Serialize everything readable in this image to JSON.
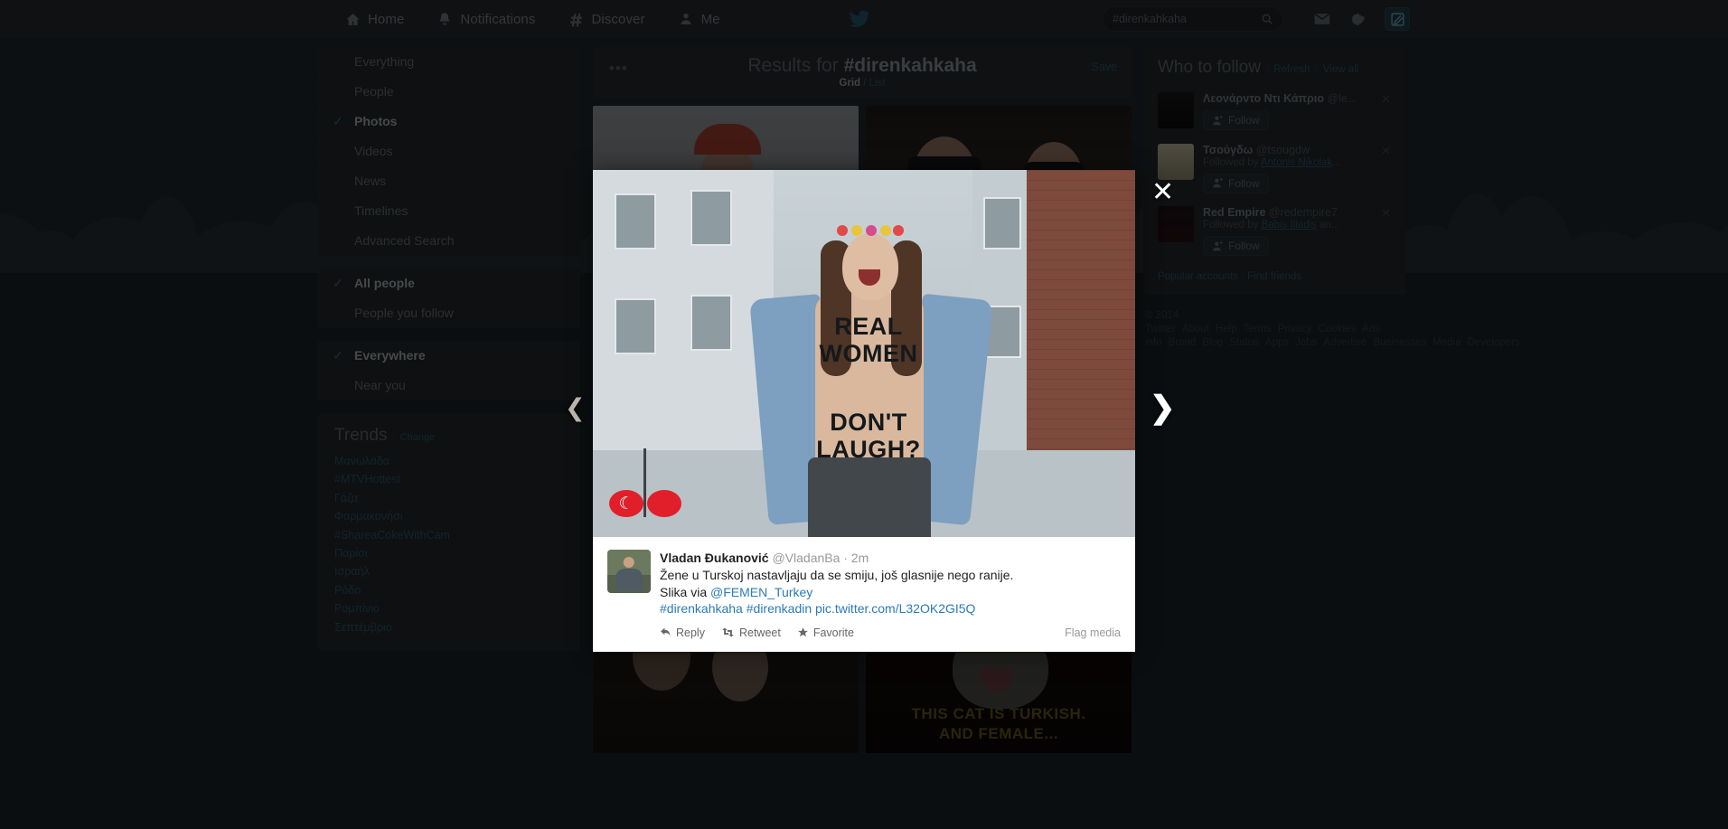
{
  "topnav": {
    "items": [
      {
        "label": "Home",
        "icon": "home-icon"
      },
      {
        "label": "Notifications",
        "icon": "bell-icon"
      },
      {
        "label": "Discover",
        "icon": "hash-icon"
      },
      {
        "label": "Me",
        "icon": "person-icon"
      }
    ],
    "logo_icon": "twitter-bird-icon",
    "search": {
      "value": "#direnkahkaha",
      "placeholder": "Search",
      "icon": "search-icon"
    },
    "messages_icon": "envelope-icon",
    "settings_icon": "gear-icon",
    "compose_icon": "compose-tweet-icon"
  },
  "sidebar": {
    "filters": [
      {
        "label": "Everything",
        "active": false
      },
      {
        "label": "People",
        "active": false
      },
      {
        "label": "Photos",
        "active": true
      },
      {
        "label": "Videos",
        "active": false
      },
      {
        "label": "News",
        "active": false
      },
      {
        "label": "Timelines",
        "active": false
      },
      {
        "label": "Advanced Search",
        "active": false
      }
    ],
    "people_filters": [
      {
        "label": "All people",
        "active": true
      },
      {
        "label": "People you follow",
        "active": false
      }
    ],
    "place_filters": [
      {
        "label": "Everywhere",
        "active": true
      },
      {
        "label": "Near you",
        "active": false
      }
    ],
    "trends": {
      "title": "Trends",
      "separator": "·",
      "change_label": "Change",
      "items": [
        "Μανωλάδα",
        "#MTVHottest",
        "Γάζα",
        "Φαρμακονήσι",
        "#ShareaCokeWithCam",
        "Παρίσι",
        "Ισραήλ",
        "Ρόδο",
        "Ρομπίνιο",
        "Σεπτέμβριο"
      ]
    }
  },
  "results": {
    "title_prefix": "Results for ",
    "query": "#direnkahkaha",
    "save_label": "Save",
    "more_icon": "more-options-icon",
    "views": {
      "grid_label": "Grid",
      "divider": "/",
      "list_label": "List",
      "active": "Grid"
    },
    "thumbnails": [
      {
        "name": "laughing-woman-street",
        "caption": ""
      },
      {
        "name": "women-in-sunglasses-car",
        "caption": ""
      },
      {
        "name": "laughing-couple-at-party",
        "caption": ""
      },
      {
        "name": "turkish-cat-meme",
        "caption": "THIS CAT IS TURKISH.\nAND FEMALE..."
      }
    ]
  },
  "who_to_follow": {
    "title": "Who to follow",
    "refresh_label": "Refresh",
    "view_all_label": "View all",
    "separator": "·",
    "follow_label": "Follow",
    "follow_icon": "add-person-icon",
    "dismiss_icon": "close-icon",
    "accounts": [
      {
        "name": "Λεονάρντο Ντι Κάπριο",
        "handle": "@le...",
        "context": "",
        "avatar": "avatar-leonardo"
      },
      {
        "name": "Τσούγδω",
        "handle": "@tsougdw",
        "context_prefix": "Followed by ",
        "context_link": "Antonis Nikolak",
        "context_suffix": "...",
        "avatar": "avatar-tsougdw"
      },
      {
        "name": "Red Empire",
        "handle": "@redempire7",
        "context_prefix": "Followed by ",
        "context_link": "Babis Iliadis",
        "context_suffix": " an...",
        "avatar": "avatar-red-empire"
      }
    ],
    "footer_links": [
      "Popular accounts",
      "Find friends"
    ]
  },
  "footer": {
    "copyright": "© 2014 Twitter",
    "links": [
      "About",
      "Help",
      "Terms",
      "Privacy",
      "Cookies",
      "Ads info",
      "Brand",
      "Blog",
      "Status",
      "Apps",
      "Jobs",
      "Advertise",
      "Businesses",
      "Media",
      "Developers"
    ]
  },
  "lightbox": {
    "close_icon": "close-icon",
    "prev_icon": "chevron-left-icon",
    "next_icon": "chevron-right-icon",
    "photo": {
      "name": "femen-protest-photo",
      "body_text_line1": "REAL",
      "body_text_line2": "WOMEN",
      "body_text_line3": "DON'T",
      "body_text_line4": "LAUGH?",
      "flag_glyph": "☾"
    },
    "tweet": {
      "author_name": "Vladan Đukanović",
      "author_handle": "@VladanBa",
      "separator": "·",
      "timestamp": "2m",
      "text_line1": "Žene u Turskoj nastavljaju da se smiju, još glasnije nego ranije.",
      "text_line2_prefix": "Slika via ",
      "text_line2_mention": "@FEMEN_Turkey",
      "hashtag1": "#direnkahkaha",
      "hashtag2": "#direnkadin",
      "pic_link": "pic.twitter.com/L32OK2GI5Q",
      "actions": [
        {
          "label": "Reply",
          "icon": "reply-arrow-icon"
        },
        {
          "label": "Retweet",
          "icon": "retweet-icon"
        },
        {
          "label": "Favorite",
          "icon": "star-icon"
        }
      ],
      "flag_media_label": "Flag media"
    }
  }
}
